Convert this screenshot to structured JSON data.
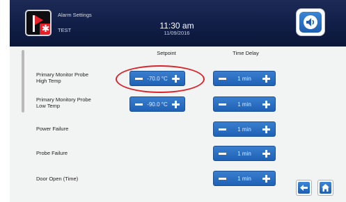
{
  "header": {
    "title": "Alarm Settings",
    "subtitle": "TEST",
    "time": "11:30 am",
    "date": "11/09/2016",
    "app_icon": "alarm-flag-snowflake-icon",
    "sound_icon": "speaker-icon"
  },
  "columns": {
    "setpoint": "Setpoint",
    "time_delay": "Time Delay"
  },
  "rows": [
    {
      "label_line1": "Primary Monitor Probe",
      "label_line2": "High Temp",
      "setpoint": "-70.0 °C",
      "time_delay": "1 min"
    },
    {
      "label_line1": "Primary Monitory Probe",
      "label_line2": "Low Temp",
      "setpoint": "-90.0 °C",
      "time_delay": "1 min"
    },
    {
      "label_line1": "Power Failure",
      "label_line2": "",
      "setpoint": "",
      "time_delay": "1 min"
    },
    {
      "label_line1": "Probe Failure",
      "label_line2": "",
      "setpoint": "",
      "time_delay": "1 min"
    },
    {
      "label_line1": "Door Open (Time)",
      "label_line2": "",
      "setpoint": "",
      "time_delay": "1 min"
    }
  ],
  "footer": {
    "back_icon": "back-arrow-icon",
    "home_icon": "home-icon"
  },
  "colors": {
    "header_bg": "#12204a",
    "stepper_blue": "#2a6fc4",
    "highlight_red": "#d8232a",
    "alarm_red": "#e8202a"
  }
}
